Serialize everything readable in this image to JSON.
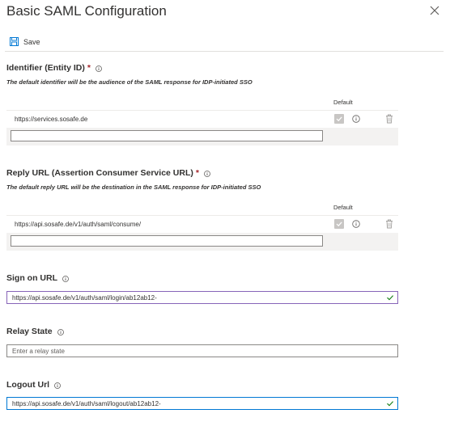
{
  "panel": {
    "title": "Basic SAML Configuration"
  },
  "toolbar": {
    "save_label": "Save"
  },
  "identifier": {
    "title": "Identifier (Entity ID)",
    "required_mark": "*",
    "description": "The default identifier will be the audience of the SAML response for IDP-initiated SSO",
    "column_default": "Default",
    "rows": [
      {
        "value": "https://services.sosafe.de"
      }
    ],
    "new_value": ""
  },
  "reply_url": {
    "title": "Reply URL (Assertion Consumer Service URL)",
    "required_mark": "*",
    "description": "The default reply URL will be the destination in the SAML response for IDP-initiated SSO",
    "column_default": "Default",
    "rows": [
      {
        "value": "https://api.sosafe.de/v1/auth/saml/consume/"
      }
    ],
    "new_value": ""
  },
  "sign_on_url": {
    "title": "Sign on URL",
    "value": "https://api.sosafe.de/v1/auth/saml/login/ab12ab12-"
  },
  "relay_state": {
    "title": "Relay State",
    "placeholder": "Enter a relay state"
  },
  "logout_url": {
    "title": "Logout Url",
    "value": "https://api.sosafe.de/v1/auth/saml/logout/ab12ab12-"
  },
  "colors": {
    "accent": "#0078d4",
    "purple_focus": "#8764b8",
    "success": "#107c10",
    "required": "#a4262c"
  }
}
